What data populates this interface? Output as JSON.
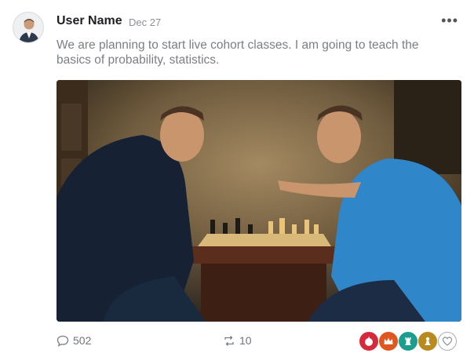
{
  "post": {
    "author": "User Name",
    "date": "Dec 27",
    "more_label": "•••",
    "text": "We are planning to start live cohort classes. I am going to teach the basics of probability, statistics.",
    "photo_description": "chess-players-photo"
  },
  "footer": {
    "comments_count": "502",
    "reposts_count": "10",
    "reactions": [
      "apple-icon",
      "crown-icon",
      "rook-icon",
      "pawn-icon",
      "heart-icon"
    ]
  },
  "colors": {
    "reaction_red": "#d42a3c",
    "reaction_orange": "#e0561f",
    "reaction_teal": "#1b9e8f",
    "reaction_gold": "#b98a1e"
  }
}
